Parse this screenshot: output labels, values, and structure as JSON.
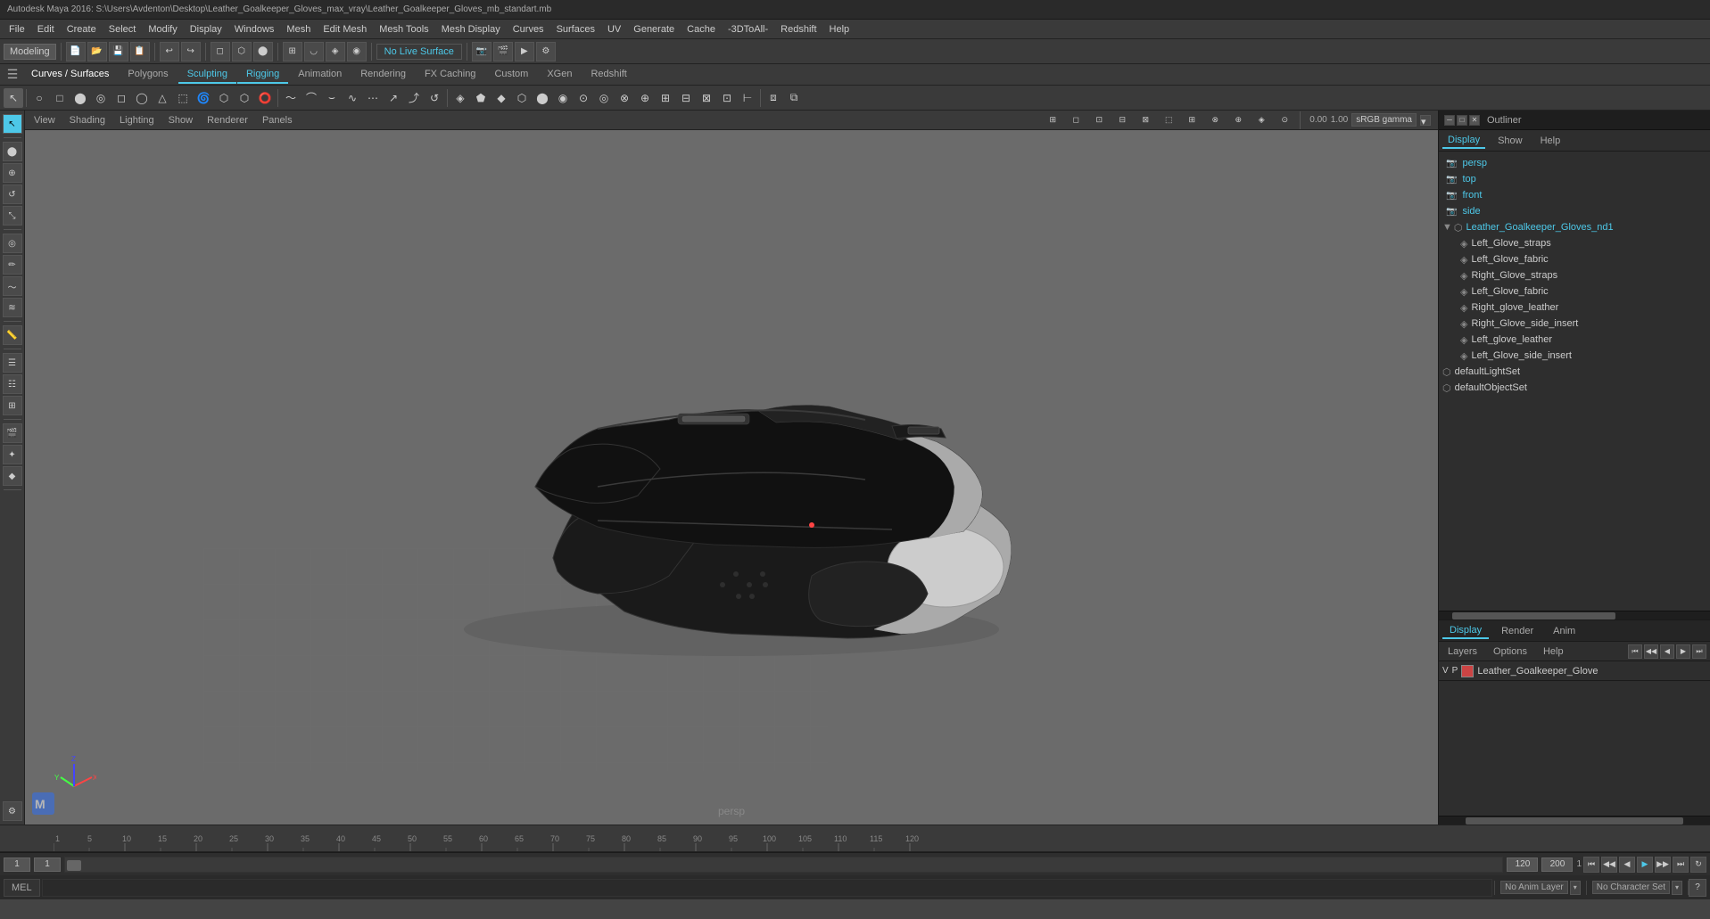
{
  "window": {
    "title": "Autodesk Maya 2016: S:\\Users\\Avdenton\\Desktop\\Leather_Goalkeeper_Gloves_max_vray\\Leather_Goalkeeper_Gloves_mb_standart.mb"
  },
  "menu": {
    "items": [
      "File",
      "Edit",
      "Create",
      "Select",
      "Modify",
      "Display",
      "Windows",
      "Mesh",
      "Edit Mesh",
      "Mesh Tools",
      "Mesh Display",
      "Curves",
      "Surfaces",
      "UV",
      "Generate",
      "Cache",
      "-3DtoAll-",
      "Redshift",
      "Help"
    ]
  },
  "toolbar": {
    "mode_label": "Modeling",
    "live_surface": "No Live Surface",
    "gamma_label": "sRGB gamma"
  },
  "tabs": {
    "curves_surfaces": "Curves / Surfaces",
    "polygons": "Polygons",
    "sculpting": "Sculpting",
    "rigging": "Rigging",
    "animation": "Animation",
    "rendering": "Rendering",
    "fx_caching": "FX Caching",
    "custom": "Custom",
    "xgen": "XGen",
    "redshift": "Redshift"
  },
  "viewport": {
    "camera_label": "persp",
    "axis_label": ""
  },
  "view_menu": {
    "items": [
      "View",
      "Shading",
      "Lighting",
      "Show",
      "Renderer",
      "Panels"
    ]
  },
  "outliner": {
    "title": "Outliner",
    "window_controls": [
      "─",
      "□",
      "✕"
    ],
    "tabs": [
      "Display",
      "Show",
      "Help"
    ],
    "cameras": [
      "persp",
      "top",
      "front",
      "side"
    ],
    "items": [
      "Leather_Goalkeeper_Gloves_nd1",
      "Left_Glove_straps",
      "Left_Glove_fabric",
      "Right_Glove_straps",
      "Left_Glove_fabric",
      "Right_glove_leather",
      "Right_Glove_side_insert",
      "Left_glove_leather",
      "Left_Glove_side_insert",
      "defaultLightSet",
      "defaultObjectSet"
    ]
  },
  "channel_box": {
    "tabs": [
      "Display",
      "Render",
      "Anim"
    ],
    "subtabs": [
      "Layers",
      "Options",
      "Help"
    ],
    "nav_buttons": [
      "◀◀",
      "◀",
      "◀",
      "▶",
      "▶▶"
    ],
    "layer_name": "Leather_Goalkeeper_Glove"
  },
  "timeline": {
    "start": "1",
    "end": "120",
    "current": "1",
    "range_end": "200",
    "ticks": [
      "1",
      "5",
      "10",
      "15",
      "20",
      "25",
      "30",
      "35",
      "40",
      "45",
      "50",
      "55",
      "60",
      "65",
      "70",
      "75",
      "80",
      "85",
      "90",
      "95",
      "100",
      "105",
      "110",
      "115",
      "120"
    ],
    "playback_controls": [
      "⏮",
      "◀◀",
      "◀",
      "▶",
      "▶▶",
      "⏭"
    ]
  },
  "status_bar": {
    "mel_label": "MEL",
    "no_anim_layer": "No Anim Layer",
    "no_character_set": "No Character Set"
  }
}
